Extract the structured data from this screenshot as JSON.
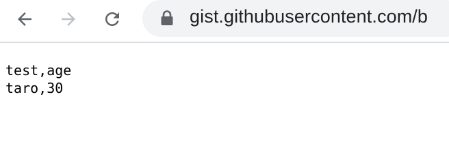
{
  "browser": {
    "url": "gist.githubusercontent.com/b",
    "icons": {
      "back": "arrow-left-icon",
      "forward": "arrow-right-icon",
      "reload": "reload-icon",
      "lock": "lock-icon"
    },
    "colors": {
      "icon_active": "#5f6368",
      "icon_disabled": "#bdc1c6",
      "omnibox_bg": "#f1f3f4",
      "url_text": "#202124"
    }
  },
  "content": {
    "lines": [
      "test,age",
      "taro,30"
    ]
  }
}
